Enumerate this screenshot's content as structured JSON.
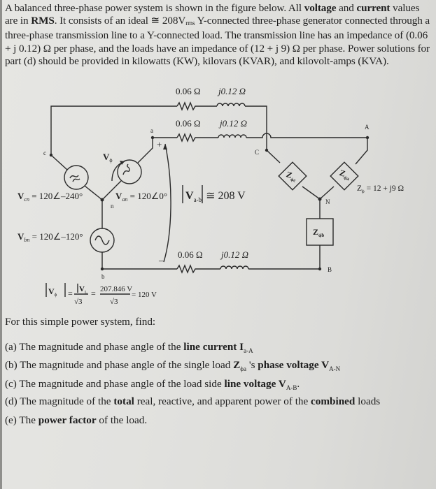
{
  "intro": {
    "p1": "A balanced three-phase power system is shown in the figure below. All ",
    "b1": "voltage",
    "p2": " and ",
    "b2": "current",
    "p3": " values are in ",
    "b3": "RMS",
    "p4": ". It consists of an ideal ≅ 208V",
    "sub1": "rms",
    "p5": " Y-connected three-phase generator connected through a three-phase transmission line to a Y-connected load. The transmission line has an impedance of (0.06 + j 0.12) Ω per phase, and the loads have an impedance of (12 + j 9) Ω per phase. Power solutions for part (d) should be provided in kilowatts (KW), kilovars (KVAR), and kilovolt-amps (KVA)."
  },
  "circuit": {
    "line_r": "0.06 Ω",
    "line_x": "j0.12 Ω",
    "node_a": "a",
    "node_b": "b",
    "node_c": "c",
    "node_n": "n",
    "node_A": "A",
    "node_B": "B",
    "node_C": "C",
    "node_N": "N",
    "vphi": "V",
    "vphi_sub": "ϕ",
    "van_label": "V",
    "van_sub": "an",
    "van_val": " = 120∠0°",
    "vbn_label": "V",
    "vbn_sub": "bn",
    "vbn_val": " = 120∠–120°",
    "vcn_label": "V",
    "vcn_sub": "cn",
    "vcn_val": " = 120∠–240°",
    "vab_label": "V",
    "vab_sub": "a-b",
    "vab_val": "≅ 208 V",
    "plus": "+",
    "minus": "–",
    "zc": "Z",
    "zc_sub": "ϕc",
    "za": "Z",
    "za_sub": "ϕa",
    "zb": "Z",
    "zb_sub": "ϕb",
    "zphi_eq": "Z",
    "zphi_sub": "ϕ",
    "zphi_val": " = 12 + j9 Ω",
    "formula_lhs": "|V",
    "formula_lhs_sub": "ϕ",
    "formula_num1": "|V",
    "formula_num1_sub": "L",
    "formula_den": "√3",
    "formula_num2": "207.846 V",
    "formula_result": "= 120 V",
    "eq": "="
  },
  "find": "For this simple power system, find:",
  "questions": [
    {
      "pre": "(a) The magnitude and phase angle of the ",
      "bold": "line current",
      "post": " I",
      "sub": "a-A"
    },
    {
      "pre": "(b) The magnitude and phase angle of the single load ",
      "bold": "Z",
      "zsub": "ϕa",
      "mid": " 's ",
      "bold2": "phase voltage V",
      "sub": "A-N"
    },
    {
      "pre": "(c) The magnitude and phase angle of the load side ",
      "bold": "line voltage",
      "post": " V",
      "sub": "A-B",
      "end": "."
    },
    {
      "pre": "(d) The magnitude of the ",
      "bold": "total",
      "mid": " real, reactive, and apparent power of the ",
      "bold2": "combined",
      "post": " loads"
    },
    {
      "pre": "(e) The ",
      "bold": "power factor",
      "post": " of the load."
    }
  ]
}
